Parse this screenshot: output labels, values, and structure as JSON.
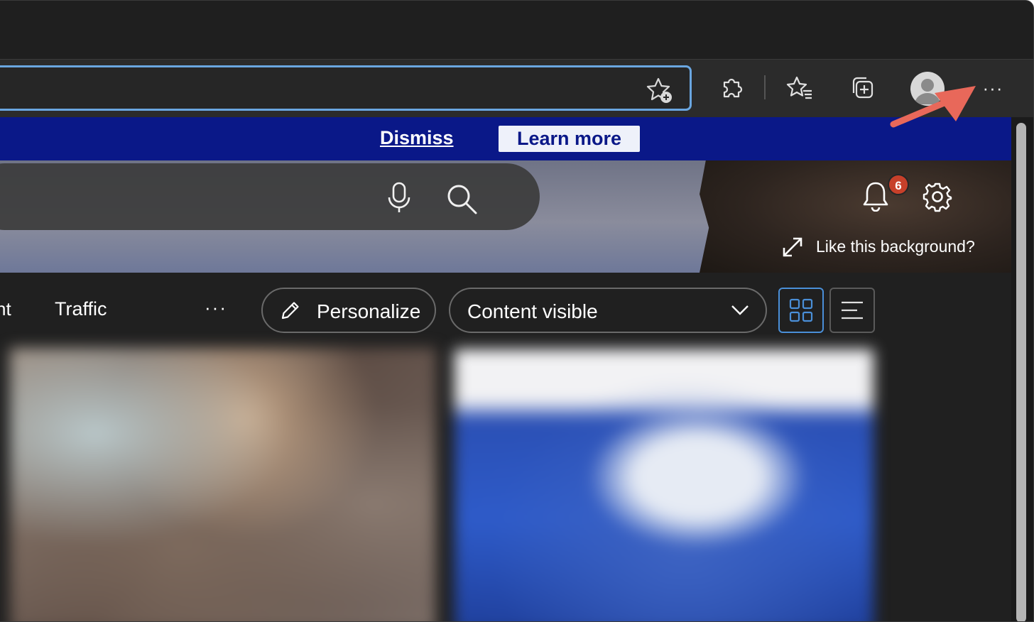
{
  "browser": {
    "toolbar": {
      "add_favorite_icon": "star-plus-icon",
      "extensions_icon": "puzzle-icon",
      "favorites_icon": "star-list-icon",
      "collections_icon": "collections-icon",
      "profile_icon": "avatar",
      "more_label": "···"
    }
  },
  "banner": {
    "dismiss_label": "Dismiss",
    "learn_more_label": "Learn more",
    "background_color": "#0a1888"
  },
  "hero": {
    "notifications_count": "6",
    "like_background_label": "Like this background?"
  },
  "nav": {
    "partial_item": "nt",
    "traffic_label": "Traffic",
    "more_label": "···",
    "personalize_label": "Personalize",
    "content_select_value": "Content visible"
  },
  "colors": {
    "accent": "#4a8fd8",
    "badge": "#c7402a",
    "annotation_arrow": "#e8685a"
  }
}
